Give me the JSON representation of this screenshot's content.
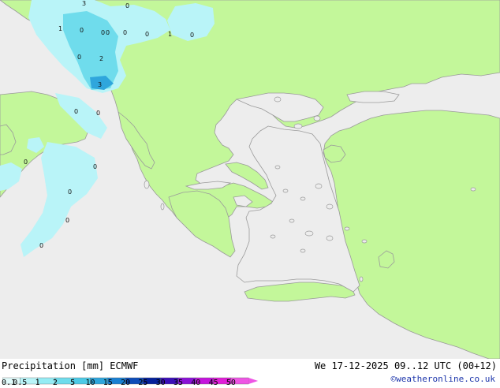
{
  "map": {
    "colors": {
      "sea": "#ededed",
      "land": "#c3f79a",
      "coast": "#9a9a9a"
    },
    "cell_labels": [
      "3",
      "0",
      "1",
      "0",
      "0",
      "0",
      "0",
      "0",
      "1",
      "0",
      "0",
      "2",
      "3",
      "0",
      "0",
      "0",
      "0",
      "0",
      "0",
      "0"
    ]
  },
  "footer": {
    "title": "Precipitation [mm] ECMWF",
    "timestamp": "We 17-12-2025 09..12 UTC (00+12)",
    "credit": "©weatheronline.co.uk"
  },
  "legend": {
    "ticks": [
      "0.1",
      "0.5",
      "1",
      "2",
      "5",
      "10",
      "15",
      "20",
      "25",
      "30",
      "35",
      "40",
      "45",
      "50"
    ],
    "colors": [
      "#e1fbfb",
      "#b9f4f8",
      "#95ecf4",
      "#6fdcec",
      "#4ccae6",
      "#2fa6dc",
      "#1a80d2",
      "#0d4cb8",
      "#05209a",
      "#3b0fb8",
      "#8a12d6",
      "#c414dc",
      "#e11ed8",
      "#ee55e4"
    ]
  }
}
